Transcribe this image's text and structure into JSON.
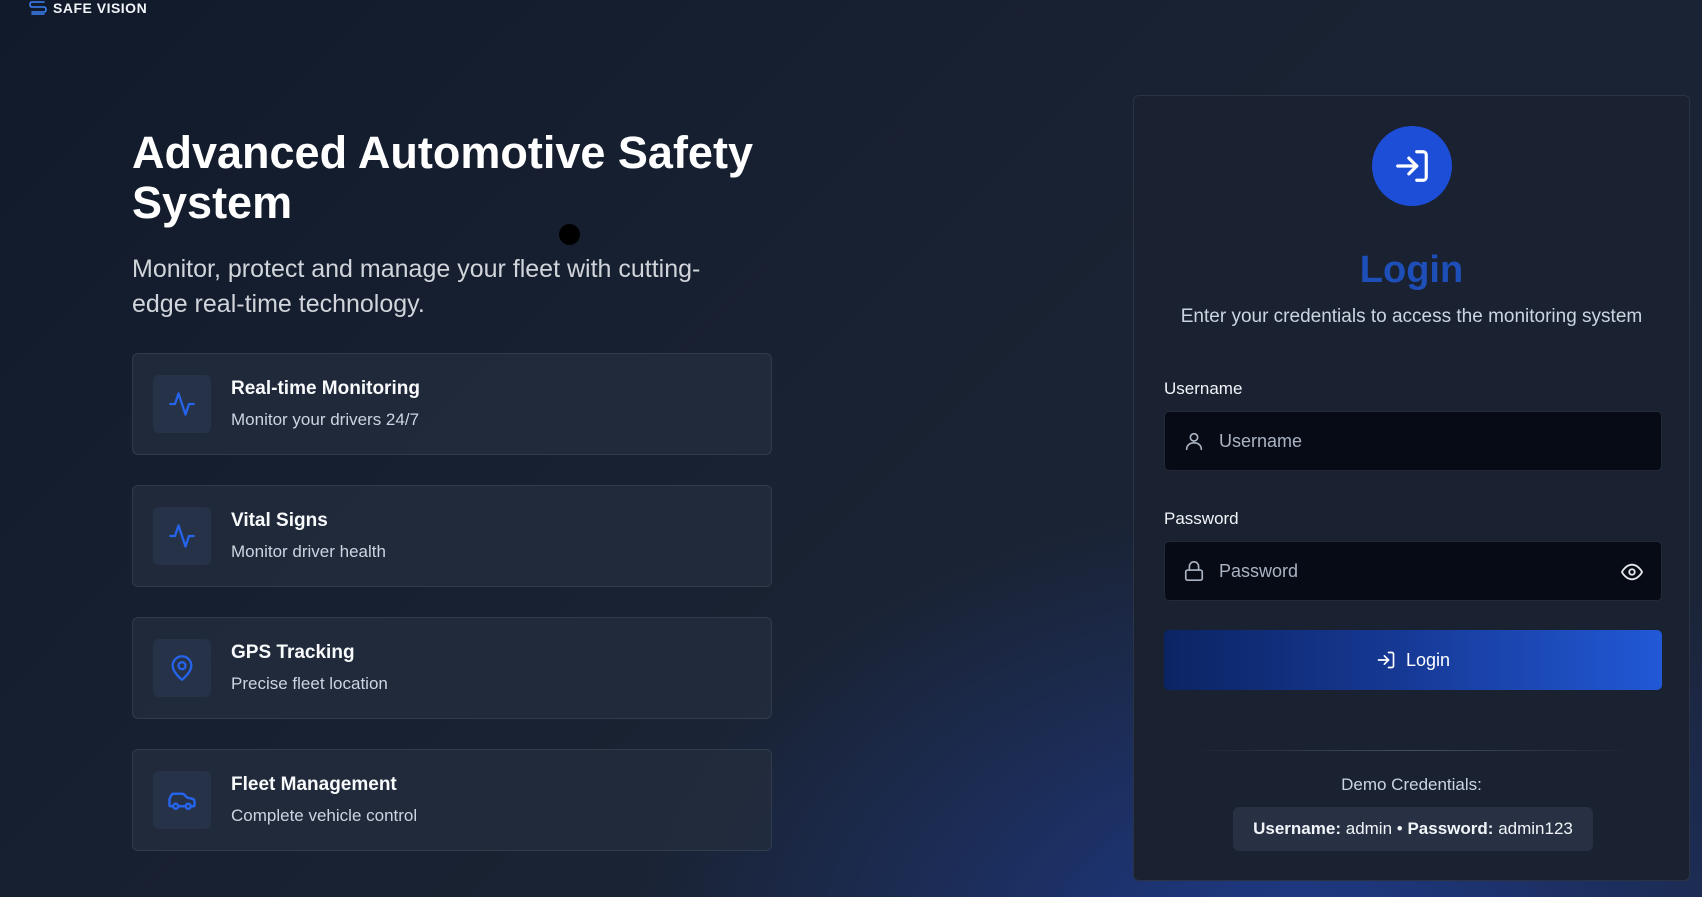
{
  "brand": {
    "name": "SAFE VISION"
  },
  "hero": {
    "title": "Advanced Automotive Safety System",
    "subtitle": "Monitor, protect and manage your fleet with cutting-edge real-time technology."
  },
  "features": [
    {
      "icon": "activity-icon",
      "title": "Real-time Monitoring",
      "desc": "Monitor your drivers 24/7"
    },
    {
      "icon": "activity-icon",
      "title": "Vital Signs",
      "desc": "Monitor driver health"
    },
    {
      "icon": "map-pin-icon",
      "title": "GPS Tracking",
      "desc": "Precise fleet location"
    },
    {
      "icon": "car-icon",
      "title": "Fleet Management",
      "desc": "Complete vehicle control"
    }
  ],
  "login": {
    "title": "Login",
    "subtitle": "Enter your credentials to access the monitoring system",
    "username_label": "Username",
    "username_placeholder": "Username",
    "password_label": "Password",
    "password_placeholder": "Password",
    "button_label": "Login",
    "demo_label": "Demo Credentials:",
    "demo_username_key": "Username:",
    "demo_username_value": "admin",
    "demo_separator": "•",
    "demo_password_key": "Password:",
    "demo_password_value": "admin123"
  },
  "colors": {
    "accent": "#1d4ed8",
    "title_blue": "#1e4fb8",
    "icon_blue": "#2563eb"
  }
}
